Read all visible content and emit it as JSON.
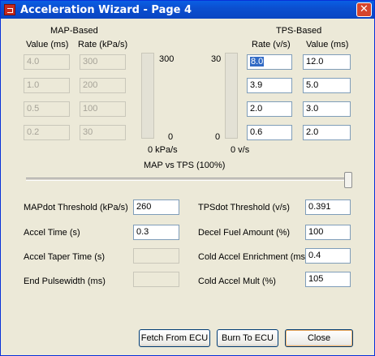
{
  "window": {
    "title": "Acceleration Wizard - Page 4",
    "close": "✕"
  },
  "map": {
    "heading": "MAP-Based",
    "col_value": "Value (ms)",
    "col_rate": "Rate (kPa/s)",
    "rows": [
      {
        "value": "4.0",
        "rate": "300"
      },
      {
        "value": "1.0",
        "rate": "200"
      },
      {
        "value": "0.5",
        "rate": "100"
      },
      {
        "value": "0.2",
        "rate": "30"
      }
    ],
    "slider_top": "300",
    "slider_bottom": "0",
    "slider_unit": "0 kPa/s"
  },
  "tps": {
    "heading": "TPS-Based",
    "col_rate": "Rate (v/s)",
    "col_value": "Value (ms)",
    "rows": [
      {
        "rate": "8.0",
        "value": "12.0"
      },
      {
        "rate": "3.9",
        "value": "5.0"
      },
      {
        "rate": "2.0",
        "value": "3.0"
      },
      {
        "rate": "0.6",
        "value": "2.0"
      }
    ],
    "slider_top": "30",
    "slider_bottom": "0",
    "slider_unit": "0 v/s"
  },
  "mix": {
    "label": "MAP vs TPS (100%)",
    "percent": 100
  },
  "settings": {
    "mapdot_label": "MAPdot Threshold (kPa/s)",
    "mapdot_value": "260",
    "accel_time_label": "Accel Time (s)",
    "accel_time_value": "0.3",
    "taper_label": "Accel Taper Time (s)",
    "taper_value": "",
    "endpw_label": "End Pulsewidth (ms)",
    "endpw_value": "",
    "tpsdot_label": "TPSdot Threshold (v/s)",
    "tpsdot_value": "0.391",
    "decel_label": "Decel Fuel Amount (%)",
    "decel_value": "100",
    "cold_enrich_label": "Cold Accel Enrichment (ms)",
    "cold_enrich_value": "0.4",
    "cold_mult_label": "Cold Accel Mult (%)",
    "cold_mult_value": "105"
  },
  "buttons": {
    "fetch": "Fetch From ECU",
    "burn": "Burn To ECU",
    "close": "Close"
  }
}
